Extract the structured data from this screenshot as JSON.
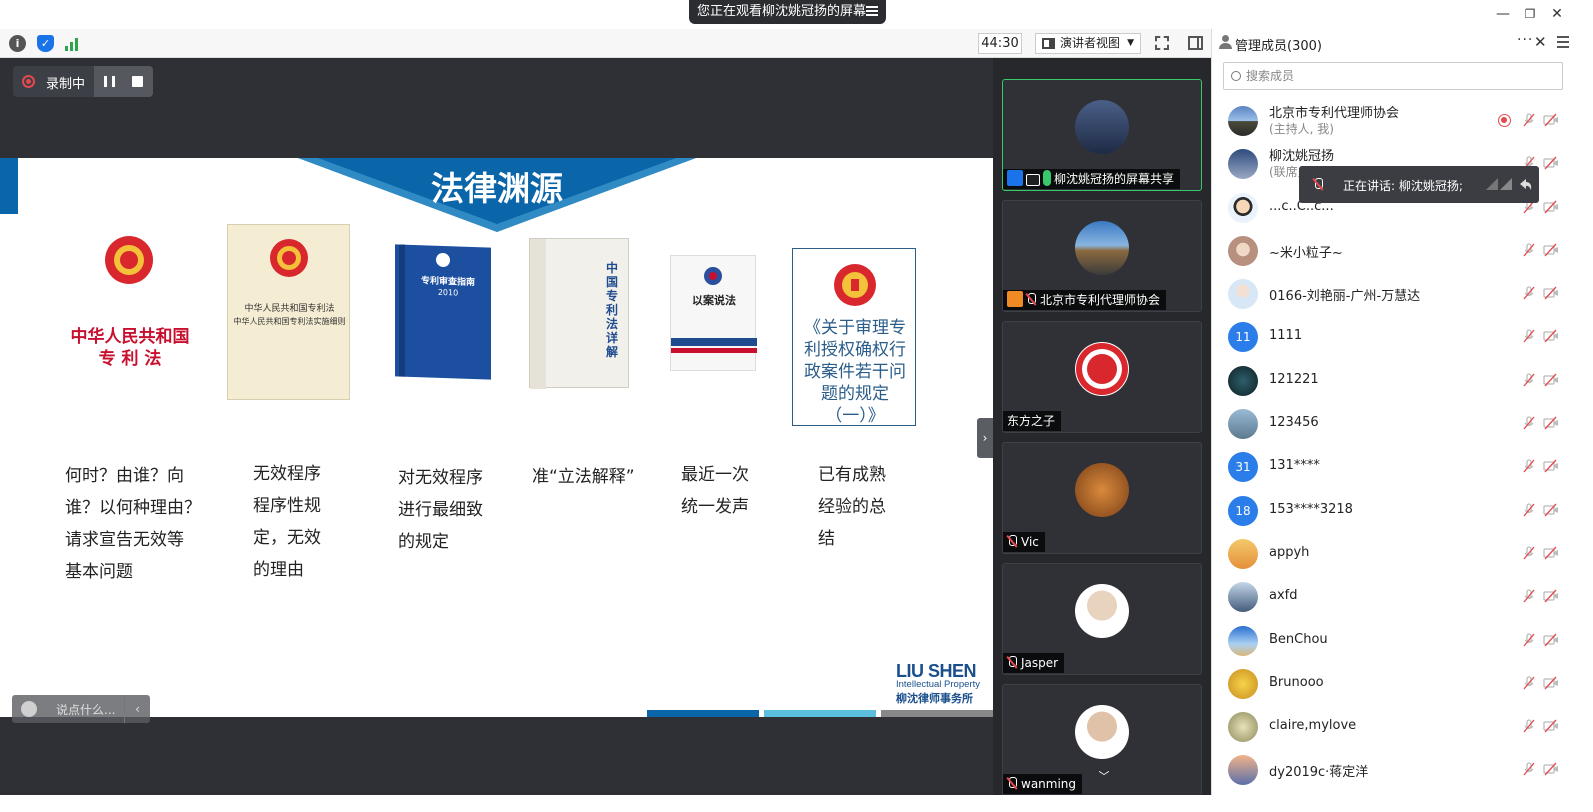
{
  "titlebar": {
    "viewing_text": "您正在观看柳沈姚冠扬的屏幕"
  },
  "toolbar": {
    "timer": "44:30",
    "view_mode": "演讲者视图"
  },
  "recording": {
    "label": "录制中"
  },
  "slide": {
    "title": "法律渊源",
    "book1_line1": "中华人民共和国",
    "book1_line2": "专 利 法",
    "book2_line1": "中华人民共和国专利法",
    "book2_line2": "中华人民共和国专利法实施细则",
    "book3_title": "专利审查指南",
    "book3_year": "2010",
    "book4_title": "中国专利法详解",
    "book5_title": "以案说法",
    "book6_text": "《关于审理专利授权确权行政案件若干问题的规定（一）》",
    "captions": [
      "何时？由谁？向\n谁？以何种理由？\n请求宣告无效等\n基本问题",
      "无效程序\n程序性规\n定，无效\n的理由",
      "对无效程序\n进行最细致\n的规定",
      "准“立法解释”",
      "最近一次\n统一发声",
      "已有成熟\n经验的总\n结"
    ],
    "logo_line1": "LIU SHEN",
    "logo_line2": "Intellectual Property",
    "logo_line3": "柳沈律师事务所"
  },
  "chat": {
    "placeholder": "说点什么..."
  },
  "videos": [
    {
      "label": "柳沈姚冠扬的屏幕共享"
    },
    {
      "label": "北京市专利代理师协会"
    },
    {
      "label": "东方之子"
    },
    {
      "label": "Vic"
    },
    {
      "label": "Jasper"
    },
    {
      "label": "wanming"
    }
  ],
  "members": {
    "title": "管理成员(300)",
    "search_placeholder": "搜索成员",
    "speaking_text": "正在讲话: 柳沈姚冠扬;",
    "list": [
      {
        "name": "北京市专利代理师协会",
        "sub": "(主持人, 我)"
      },
      {
        "name": "柳沈姚冠扬",
        "sub": "(联席主"
      },
      {
        "name": "...c..C..c..."
      },
      {
        "name": "~米小粒子~"
      },
      {
        "name": "0166-刘艳丽-广州-万慧达"
      },
      {
        "name": "1111",
        "initials": "11"
      },
      {
        "name": "121221"
      },
      {
        "name": "123456"
      },
      {
        "name": "131****",
        "initials": "31"
      },
      {
        "name": "153****3218",
        "initials": "18"
      },
      {
        "name": "appyh"
      },
      {
        "name": "axfd"
      },
      {
        "name": "BenChou"
      },
      {
        "name": "Brunooo"
      },
      {
        "name": "claire,mylove"
      },
      {
        "name": "dy2019c·蒋定洋"
      }
    ]
  }
}
